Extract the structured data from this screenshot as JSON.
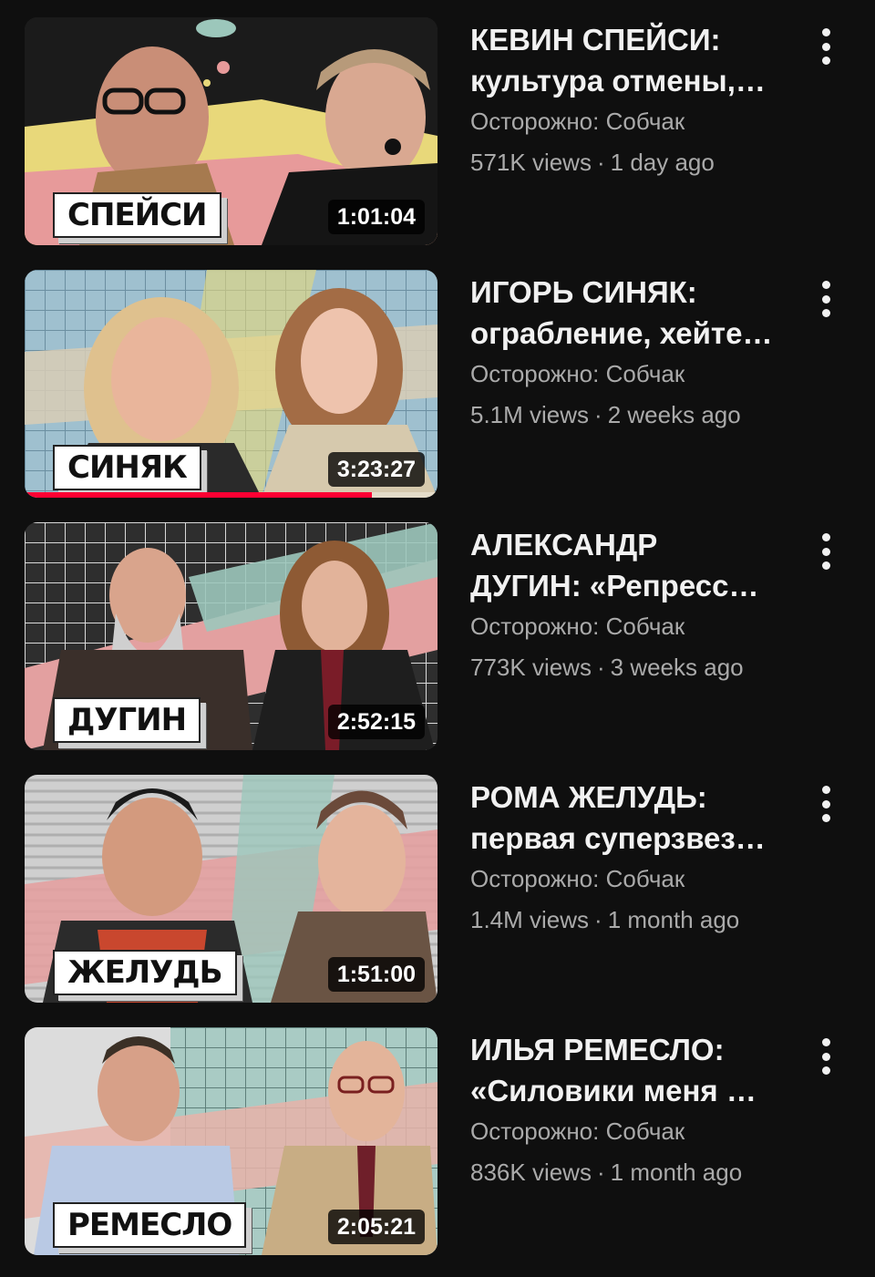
{
  "videos": [
    {
      "title_line1": "КЕВИН СПЕЙСИ:",
      "title_line2": "культура отмены,…",
      "channel": "Осторожно: Собчак",
      "views": "571K views",
      "age": "1 day ago",
      "duration": "1:01:04",
      "thumb_label": "СПЕЙСИ",
      "watch_progress": null
    },
    {
      "title_line1": "ИГОРЬ СИНЯК:",
      "title_line2": "ограбление, хейте…",
      "channel": "Осторожно: Собчак",
      "views": "5.1M views",
      "age": "2 weeks ago",
      "duration": "3:23:27",
      "thumb_label": "СИНЯК",
      "watch_progress": 0.84
    },
    {
      "title_line1": "АЛЕКСАНДР",
      "title_line2": "ДУГИН: «Репресс…",
      "channel": "Осторожно: Собчак",
      "views": "773K views",
      "age": "3 weeks ago",
      "duration": "2:52:15",
      "thumb_label": "ДУГИН",
      "watch_progress": null
    },
    {
      "title_line1": "РОМА ЖЕЛУДЬ:",
      "title_line2": "первая суперзвез…",
      "channel": "Осторожно: Собчак",
      "views": "1.4M views",
      "age": "1 month ago",
      "duration": "1:51:00",
      "thumb_label": "ЖЕЛУДЬ",
      "watch_progress": null
    },
    {
      "title_line1": "ИЛЬЯ РЕМЕСЛО:",
      "title_line2": "«Силовики меня …",
      "channel": "Осторожно: Собчак",
      "views": "836K views",
      "age": "1 month ago",
      "duration": "2:05:21",
      "thumb_label": "РЕМЕСЛО",
      "watch_progress": null
    }
  ],
  "separator": "·",
  "colors": {
    "background": "#0f0f0f",
    "title_text": "#f1f1f1",
    "secondary_text": "#aaaaaa",
    "progress_red": "#ff0033"
  },
  "icons": {
    "more": "three-dot-vertical-icon"
  }
}
